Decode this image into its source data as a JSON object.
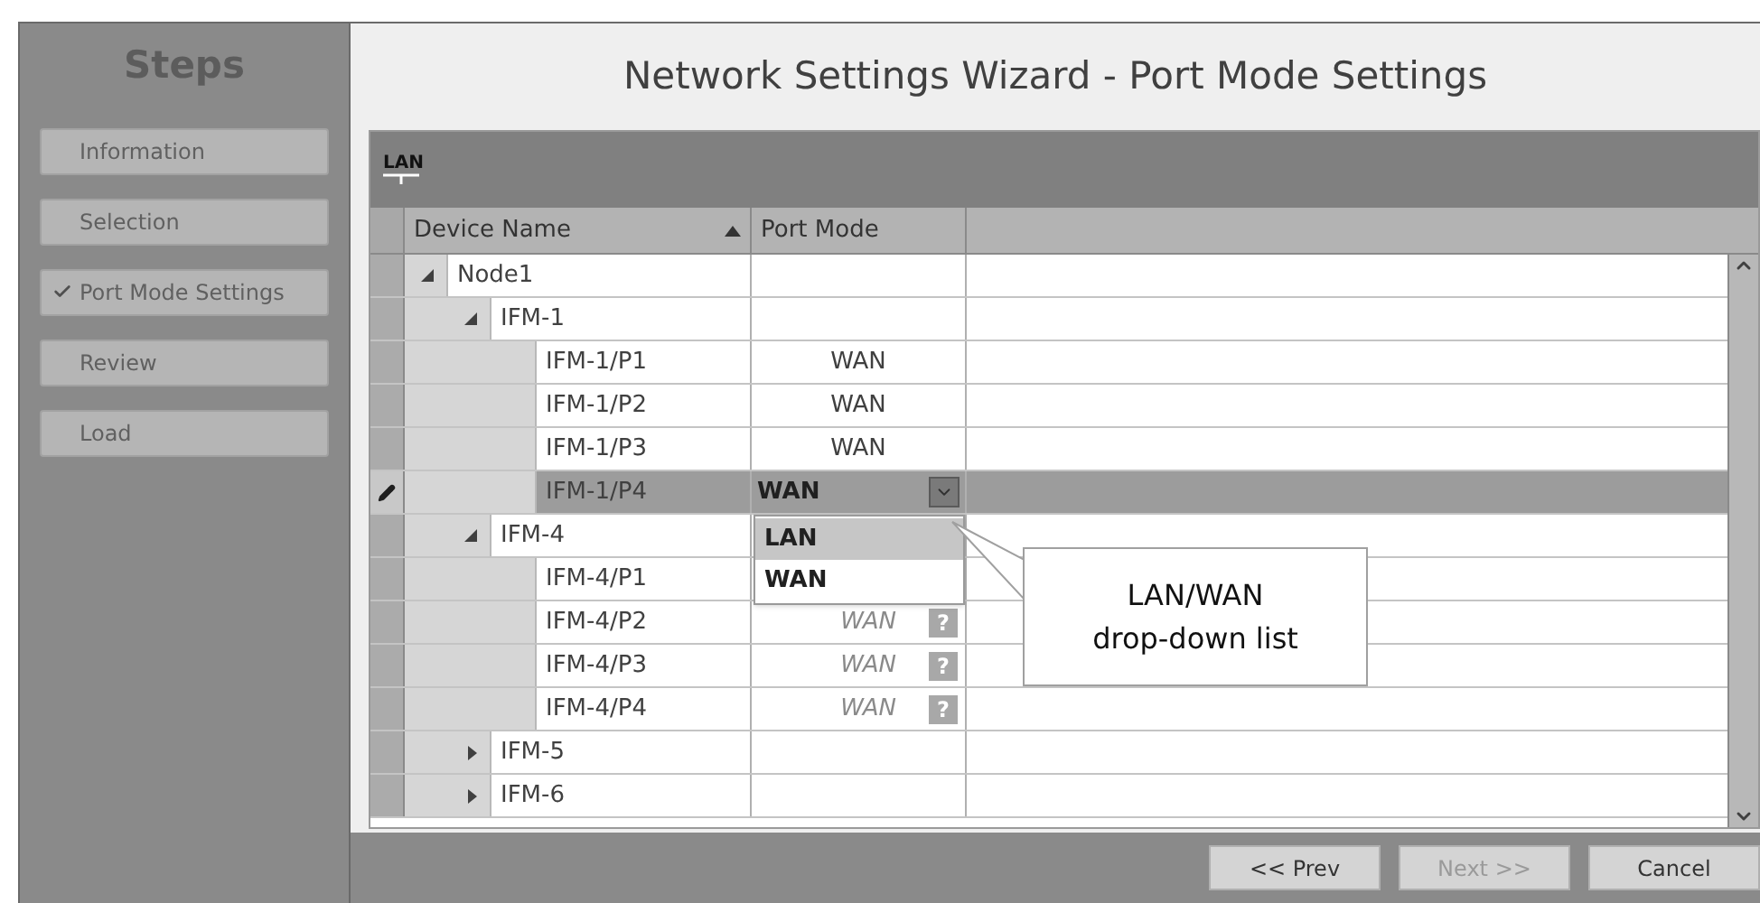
{
  "sidebar": {
    "title": "Steps",
    "items": [
      {
        "label": "Information",
        "checked": false
      },
      {
        "label": "Selection",
        "checked": false
      },
      {
        "label": "Port Mode Settings",
        "checked": true
      },
      {
        "label": "Review",
        "checked": false
      },
      {
        "label": "Load",
        "checked": false
      }
    ]
  },
  "title": "Network Settings Wizard - Port Mode Settings",
  "panel": {
    "label": "LAN"
  },
  "table": {
    "columns": [
      {
        "label": "Device Name",
        "sorted": true
      },
      {
        "label": "Port Mode",
        "sorted": false
      }
    ],
    "rows": [
      {
        "name": "Node1",
        "expanded": true,
        "selected": false,
        "children": [
          {
            "name": "IFM-1",
            "expanded": true,
            "selected": false,
            "children": [
              {
                "name": "IFM-1/P1",
                "kind": "set",
                "port_mode": "WAN",
                "selected": false
              },
              {
                "name": "IFM-1/P2",
                "kind": "set",
                "port_mode": "WAN",
                "selected": false
              },
              {
                "name": "IFM-1/P3",
                "kind": "set",
                "port_mode": "WAN",
                "selected": false
              },
              {
                "name": "IFM-1/P4",
                "kind": "editing",
                "port_mode": "WAN",
                "selected": true,
                "options": [
                  {
                    "label": "LAN",
                    "selected": true
                  },
                  {
                    "label": "WAN",
                    "selected": false
                  }
                ]
              }
            ]
          },
          {
            "name": "IFM-4",
            "expanded": true,
            "selected": false,
            "children": [
              {
                "name": "IFM-4/P1",
                "kind": "hidden",
                "selected": false
              },
              {
                "name": "IFM-4/P2",
                "kind": "pending",
                "port_mode": "WAN",
                "badge": "?",
                "selected": false
              },
              {
                "name": "IFM-4/P3",
                "kind": "pending",
                "port_mode": "WAN",
                "badge": "?",
                "selected": false
              },
              {
                "name": "IFM-4/P4",
                "kind": "pending",
                "port_mode": "WAN",
                "badge": "?",
                "selected": false
              }
            ]
          },
          {
            "name": "IFM-5",
            "expanded": false,
            "selected": false
          },
          {
            "name": "IFM-6",
            "expanded": false,
            "selected": false
          }
        ]
      }
    ]
  },
  "callout": {
    "lines": [
      "LAN/WAN",
      "drop-down list"
    ]
  },
  "buttons": [
    {
      "label": "<< Prev",
      "disabled": false
    },
    {
      "label": "Next >>",
      "disabled": true
    },
    {
      "label": "Cancel",
      "disabled": false
    }
  ]
}
